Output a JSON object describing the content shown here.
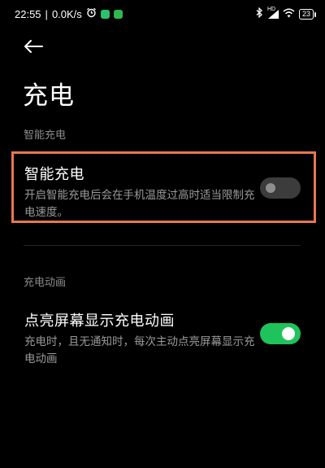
{
  "status_bar": {
    "time": "22:55",
    "network_speed": "0.0K/s",
    "signal_label": "HD",
    "battery": "23",
    "icons": [
      "alarm-icon",
      "chat-app-icon",
      "wechat-app-icon",
      "bluetooth-icon",
      "signal-icon",
      "wifi-icon",
      "battery-icon"
    ],
    "app_colors": [
      "#2bc16b",
      "#2fb84d"
    ]
  },
  "header": {
    "back_icon": "back-arrow-icon",
    "title": "充电"
  },
  "sections": [
    {
      "header": "智能充电",
      "settings": [
        {
          "title": "智能充电",
          "description": "开启智能充电后会在手机温度过高时适当限制充电速度。",
          "toggle_on": false
        }
      ]
    },
    {
      "header": "充电动画",
      "settings": [
        {
          "title": "点亮屏幕显示充电动画",
          "description": "充电时，且无通知时，每次主动点亮屏幕显示充电动画",
          "toggle_on": true
        }
      ]
    }
  ],
  "colors": {
    "background": "#000000",
    "toggle_on": "#1ec45b",
    "toggle_off": "#3c3c3c",
    "highlight_border": "#e8774f",
    "secondary_text": "#9a9a9a"
  }
}
